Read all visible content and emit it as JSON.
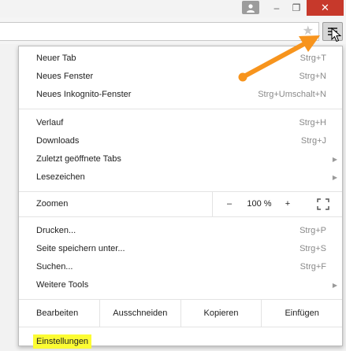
{
  "window": {
    "minimize_glyph": "–",
    "restore_glyph": "❐",
    "close_glyph": "✕"
  },
  "toolbar": {
    "bookmark_star": "★",
    "menu_icon": "hamburger-menu-icon"
  },
  "menu": {
    "group1": [
      {
        "label": "Neuer Tab",
        "shortcut": "Strg+T"
      },
      {
        "label": "Neues Fenster",
        "shortcut": "Strg+N"
      },
      {
        "label": "Neues Inkognito-Fenster",
        "shortcut": "Strg+Umschalt+N"
      }
    ],
    "group2": [
      {
        "label": "Verlauf",
        "shortcut": "Strg+H"
      },
      {
        "label": "Downloads",
        "shortcut": "Strg+J"
      },
      {
        "label": "Zuletzt geöffnete Tabs",
        "arrow": "▶"
      },
      {
        "label": "Lesezeichen",
        "arrow": "▶"
      }
    ],
    "zoom": {
      "label": "Zoomen",
      "minus": "–",
      "value": "100 %",
      "plus": "+"
    },
    "group3": [
      {
        "label": "Drucken...",
        "shortcut": "Strg+P"
      },
      {
        "label": "Seite speichern unter...",
        "shortcut": "Strg+S"
      },
      {
        "label": "Suchen...",
        "shortcut": "Strg+F"
      },
      {
        "label": "Weitere Tools",
        "arrow": "▶"
      }
    ],
    "edit": {
      "label": "Bearbeiten",
      "cut": "Ausschneiden",
      "copy": "Kopieren",
      "paste": "Einfügen"
    },
    "settings": {
      "label": "Einstellungen"
    }
  },
  "colors": {
    "annotation_arrow": "#f7941d",
    "highlight": "#fcfc33",
    "close_button": "#c7392b"
  }
}
